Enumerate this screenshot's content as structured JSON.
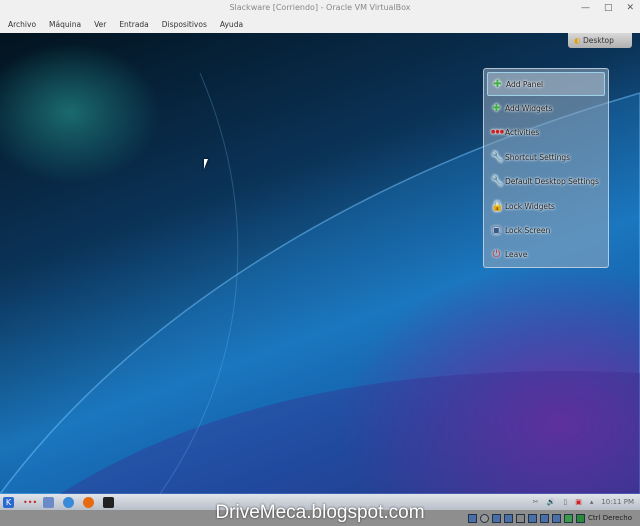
{
  "window": {
    "title": "Slackware [Corriendo] - Oracle VM VirtualBox",
    "minimize": "—",
    "maximize": "□",
    "close": "✕"
  },
  "menubar": [
    "Archivo",
    "Máquina",
    "Ver",
    "Entrada",
    "Dispositivos",
    "Ayuda"
  ],
  "desktop": {
    "toolbox_label": "Desktop"
  },
  "context_menu": [
    {
      "label": "Add Panel",
      "icon": "plus-icon",
      "glyph": "✚",
      "color": "#3cb043"
    },
    {
      "label": "Add Widgets",
      "icon": "plus-icon",
      "glyph": "✚",
      "color": "#3cb043"
    },
    {
      "label": "Activities",
      "icon": "activities-icon",
      "glyph": "●●●",
      "color": "#c22"
    },
    {
      "label": "Shortcut Settings",
      "icon": "wrench-icon",
      "glyph": "🔧",
      "color": "#444"
    },
    {
      "label": "Default Desktop Settings",
      "icon": "wrench-icon",
      "glyph": "🔧",
      "color": "#444"
    },
    {
      "label": "Lock Widgets",
      "icon": "lock-icon",
      "glyph": "🔒",
      "color": "#d4a800"
    },
    {
      "label": "Lock Screen",
      "icon": "lock-screen-icon",
      "glyph": "▣",
      "color": "#3a5a8a"
    },
    {
      "label": "Leave",
      "icon": "power-icon",
      "glyph": "⏻",
      "color": "#c22"
    }
  ],
  "panel": {
    "clock": "10:11 PM"
  },
  "statusbar": {
    "host_key": "Ctrl Derecho"
  },
  "watermark": "DriveMeca.blogspot.com"
}
